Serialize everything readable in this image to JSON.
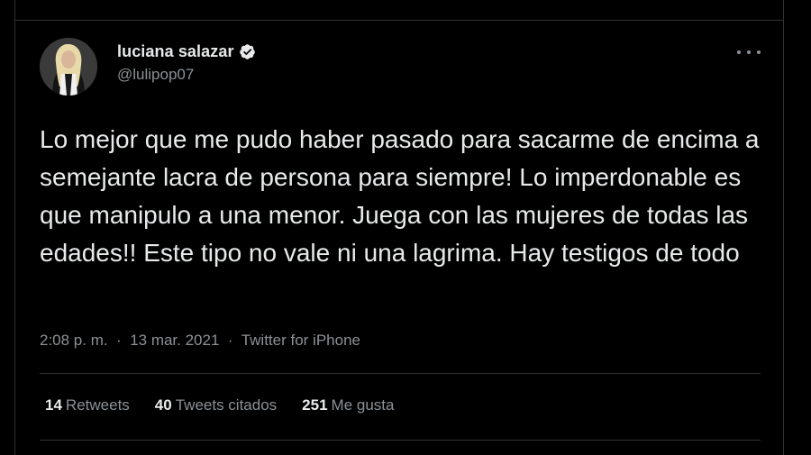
{
  "author": {
    "display_name": "luciana salazar",
    "handle": "@lulipop07",
    "verified": true
  },
  "icons": {
    "verified": "verified-badge-icon",
    "more": "more-options-icon"
  },
  "tweet": {
    "text": "Lo mejor que me pudo haber pasado para sacarme de encima a semejante lacra de persona para siempre! Lo imperdonable es que manipulo a una menor. Juega con las mujeres de todas las edades!! Este tipo no vale ni una lagrima. Hay testigos de todo",
    "time": "2:08 p. m.",
    "date": "13 mar. 2021",
    "source": "Twitter for iPhone",
    "separator": "·"
  },
  "stats": {
    "retweets": {
      "count": "14",
      "label": "Retweets"
    },
    "quotes": {
      "count": "40",
      "label": "Tweets citados"
    },
    "likes": {
      "count": "251",
      "label": "Me gusta"
    }
  },
  "colors": {
    "background": "#000000",
    "text_primary": "#e7e9ea",
    "text_secondary": "#8b9196",
    "border": "#2f3336"
  }
}
